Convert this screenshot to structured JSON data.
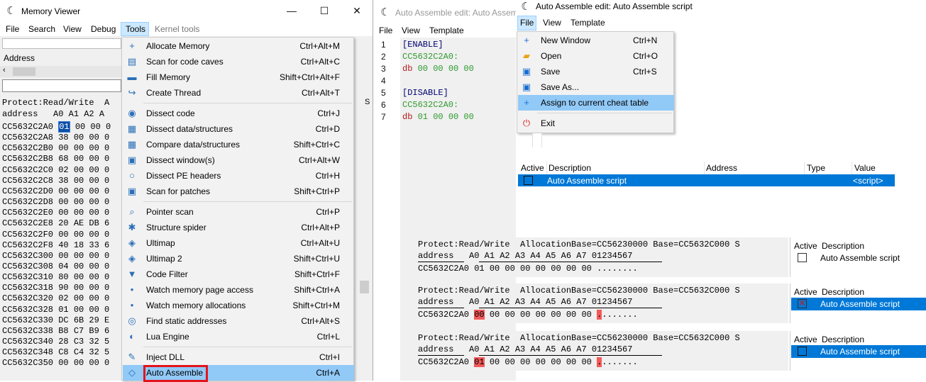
{
  "memory_viewer": {
    "title": "Memory Viewer",
    "menu": [
      "File",
      "Search",
      "View",
      "Debug",
      "Tools",
      "Kernel tools"
    ],
    "address_label": "Address",
    "protect_line": "Protect:Read/Write  A",
    "header_line": "address   A0 A1 A2 A",
    "rows": [
      {
        "addr": "CC5632C2A0",
        "b0": "01",
        "rest": " 00 00 0"
      },
      {
        "addr": "CC5632C2A8",
        "b0": "38",
        "rest": " 00 00 0"
      },
      {
        "addr": "CC5632C2B0",
        "b0": "00",
        "rest": " 00 00 0"
      },
      {
        "addr": "CC5632C2B8",
        "b0": "68",
        "rest": " 00 00 0"
      },
      {
        "addr": "CC5632C2C0",
        "b0": "02",
        "rest": " 00 00 0"
      },
      {
        "addr": "CC5632C2C8",
        "b0": "38",
        "rest": " 00 00 0"
      },
      {
        "addr": "CC5632C2D0",
        "b0": "00",
        "rest": " 00 00 0"
      },
      {
        "addr": "CC5632C2D8",
        "b0": "00",
        "rest": " 00 00 0"
      },
      {
        "addr": "CC5632C2E0",
        "b0": "00",
        "rest": " 00 00 0"
      },
      {
        "addr": "CC5632C2E8",
        "b0": "20",
        "rest": " AE DB 6"
      },
      {
        "addr": "CC5632C2F0",
        "b0": "00",
        "rest": " 00 00 0"
      },
      {
        "addr": "CC5632C2F8",
        "b0": "40",
        "rest": " 18 33 6"
      },
      {
        "addr": "CC5632C300",
        "b0": "00",
        "rest": " 00 00 0"
      },
      {
        "addr": "CC5632C308",
        "b0": "04",
        "rest": " 00 00 0"
      },
      {
        "addr": "CC5632C310",
        "b0": "80",
        "rest": " 00 00 0"
      },
      {
        "addr": "CC5632C318",
        "b0": "90",
        "rest": " 00 00 0"
      },
      {
        "addr": "CC5632C320",
        "b0": "02",
        "rest": " 00 00 0"
      },
      {
        "addr": "CC5632C328",
        "b0": "01",
        "rest": " 00 00 0"
      },
      {
        "addr": "CC5632C330",
        "b0": "DC",
        "rest": " 6B 29 E"
      },
      {
        "addr": "CC5632C338",
        "b0": "B8",
        "rest": " C7 B9 6"
      },
      {
        "addr": "CC5632C340",
        "b0": "28",
        "rest": " C3 32 5"
      },
      {
        "addr": "CC5632C348",
        "b0": "C8",
        "rest": " C4 32 5"
      },
      {
        "addr": "CC5632C350",
        "b0": "00",
        "rest": " 00 00 0"
      }
    ]
  },
  "tools_menu": [
    {
      "label": "Allocate Memory",
      "shortcut": "Ctrl+Alt+M",
      "icon": "allocate-icon",
      "glyph": "+"
    },
    {
      "label": "Scan for code caves",
      "shortcut": "Ctrl+Alt+C",
      "icon": "code-cave-icon",
      "glyph": "▤"
    },
    {
      "label": "Fill Memory",
      "shortcut": "Shift+Ctrl+Alt+F",
      "icon": "fill-memory-icon",
      "glyph": "▬"
    },
    {
      "label": "Create Thread",
      "shortcut": "Ctrl+Alt+T",
      "icon": "thread-icon",
      "glyph": "↪"
    },
    {
      "label": "Dissect code",
      "shortcut": "Ctrl+J",
      "icon": "dissect-code-icon",
      "glyph": "◉"
    },
    {
      "label": "Dissect data/structures",
      "shortcut": "Ctrl+D",
      "icon": "structures-icon",
      "glyph": "▦"
    },
    {
      "label": "Compare data/structures",
      "shortcut": "Shift+Ctrl+C",
      "icon": "compare-icon",
      "glyph": "▦"
    },
    {
      "label": "Dissect window(s)",
      "shortcut": "Ctrl+Alt+W",
      "icon": "window-icon",
      "glyph": "▣"
    },
    {
      "label": "Dissect PE headers",
      "shortcut": "Ctrl+H",
      "icon": "pe-headers-icon",
      "glyph": "○"
    },
    {
      "label": "Scan for patches",
      "shortcut": "Shift+Ctrl+P",
      "icon": "patches-icon",
      "glyph": "▣"
    },
    {
      "label": "Pointer scan",
      "shortcut": "Ctrl+P",
      "icon": "pointer-scan-icon",
      "glyph": "⌕"
    },
    {
      "label": "Structure spider",
      "shortcut": "Ctrl+Alt+P",
      "icon": "spider-icon",
      "glyph": "✱"
    },
    {
      "label": "Ultimap",
      "shortcut": "Ctrl+Alt+U",
      "icon": "ultimap-icon",
      "glyph": "◈"
    },
    {
      "label": "Ultimap 2",
      "shortcut": "Shift+Ctrl+U",
      "icon": "ultimap2-icon",
      "glyph": "◈"
    },
    {
      "label": "Code Filter",
      "shortcut": "Shift+Ctrl+F",
      "icon": "filter-icon",
      "glyph": "▼"
    },
    {
      "label": "Watch memory page access",
      "shortcut": "Shift+Ctrl+A",
      "icon": "watch-page-icon",
      "glyph": "•"
    },
    {
      "label": "Watch memory allocations",
      "shortcut": "Shift+Ctrl+M",
      "icon": "watch-alloc-icon",
      "glyph": "•"
    },
    {
      "label": "Find static addresses",
      "shortcut": "Ctrl+Alt+S",
      "icon": "static-addr-icon",
      "glyph": "◎"
    },
    {
      "label": "Lua Engine",
      "shortcut": "Ctrl+L",
      "icon": "lua-icon",
      "glyph": "◐"
    },
    {
      "label": "Inject DLL",
      "shortcut": "Ctrl+I",
      "icon": "inject-icon",
      "glyph": "✎"
    },
    {
      "label": "Auto Assemble",
      "shortcut": "Ctrl+A",
      "icon": "auto-assemble-icon",
      "glyph": "◇"
    }
  ],
  "aa_edit_left": {
    "title": "Auto Assemble edit: Auto Assem",
    "menu": [
      "File",
      "View",
      "Template"
    ],
    "lines": [
      {
        "n": "1",
        "text": "[ENABLE]",
        "cls": "kw"
      },
      {
        "n": "2",
        "text": "CC5632C2A0:",
        "cls": "lbl"
      },
      {
        "n": "3",
        "kw": "db",
        "text": " 00 00 00 00",
        "cls": "lbl"
      },
      {
        "n": "4",
        "text": "",
        "cls": ""
      },
      {
        "n": "5",
        "text": "[DISABLE]",
        "cls": "kw"
      },
      {
        "n": "6",
        "text": "CC5632C2A0:",
        "cls": "lbl"
      },
      {
        "n": "7",
        "kw": "db",
        "text": " 01 00 00 00",
        "cls": "lbl"
      }
    ]
  },
  "aa_edit_right": {
    "title": "Auto Assemble edit: Auto Assemble script",
    "menu": [
      "File",
      "View",
      "Template"
    ],
    "file_menu": [
      {
        "label": "New Window",
        "shortcut": "Ctrl+N",
        "icon": "new-window-icon",
        "glyph": "+",
        "color": "#1a6fd1"
      },
      {
        "label": "Open",
        "shortcut": "Ctrl+O",
        "icon": "open-folder-icon",
        "glyph": "▰",
        "color": "#e8a21a"
      },
      {
        "label": "Save",
        "shortcut": "Ctrl+S",
        "icon": "save-icon",
        "glyph": "▣",
        "color": "#1a6fd1"
      },
      {
        "label": "Save As...",
        "shortcut": "",
        "icon": "save-as-icon",
        "glyph": "▣",
        "color": "#1a6fd1"
      },
      {
        "label": "Assign to current cheat table",
        "shortcut": "",
        "icon": "assign-icon",
        "glyph": "+",
        "color": "#1a6fd1"
      },
      {
        "label": "Exit",
        "shortcut": "",
        "icon": "exit-icon",
        "glyph": "⏻",
        "color": "#d22"
      }
    ]
  },
  "cheat_table": {
    "headers": [
      "Active",
      "Description",
      "Address",
      "Type",
      "Value"
    ],
    "row": {
      "description": "Auto Assemble script",
      "value": "<script>"
    }
  },
  "bottom_panels": [
    {
      "protect": "Protect:Read/Write  AllocationBase=CC56230000 Base=CC5632C000 S",
      "header": "address   A0 A1 A2 A3 A4 A5 A6 A7 01234567",
      "addr": "CC5632C2A0",
      "b0": "01",
      "rest": " 00 00 00 00 00 00 00 ",
      "ascii0": ".",
      "ascii_rest": ".......",
      "red": false,
      "ct_header": [
        "Active",
        "Description"
      ],
      "ct_desc": "Auto Assemble script",
      "ct_state": "unchecked"
    },
    {
      "protect": "Protect:Read/Write  AllocationBase=CC56230000 Base=CC5632C000 S",
      "header": "address   A0 A1 A2 A3 A4 A5 A6 A7 01234567",
      "addr": "CC5632C2A0",
      "b0": "00",
      "rest": " 00 00 00 00 00 00 00 ",
      "ascii0": ".",
      "ascii_rest": ".......",
      "red": true,
      "ct_header": [
        "Active",
        "Description"
      ],
      "ct_desc": "Auto Assemble script",
      "ct_state": "checked"
    },
    {
      "protect": "Protect:Read/Write  AllocationBase=CC56230000 Base=CC5632C000 S",
      "header": "address   A0 A1 A2 A3 A4 A5 A6 A7 01234567",
      "addr": "CC5632C2A0",
      "b0": "01",
      "rest": " 00 00 00 00 00 00 00 ",
      "ascii0": ".",
      "ascii_rest": ".......",
      "red": true,
      "ct_header": [
        "Active",
        "Description"
      ],
      "ct_desc": "Auto Assemble script",
      "ct_state": "dark"
    }
  ]
}
